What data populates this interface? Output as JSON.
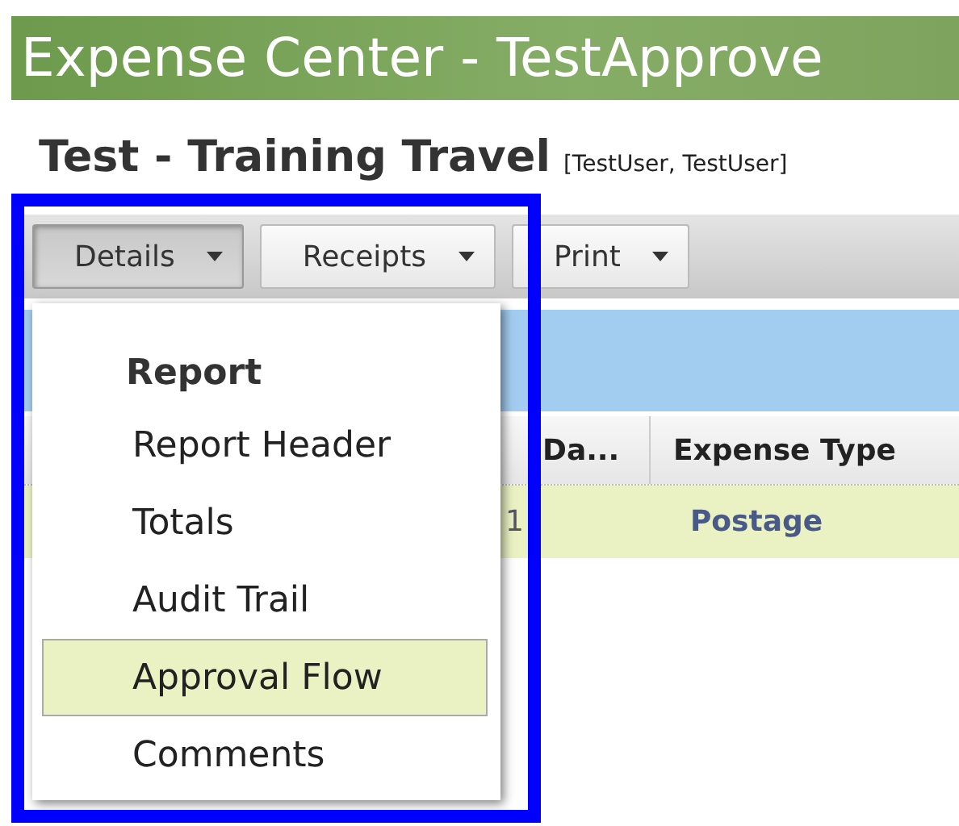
{
  "header": {
    "title": "Expense Center - TestApprove"
  },
  "report": {
    "title": "Test - Training Travel",
    "owner": "[TestUser, TestUser]"
  },
  "toolbar": {
    "buttons": [
      {
        "label": "Details",
        "pressed": true
      },
      {
        "label": "Receipts",
        "pressed": false
      },
      {
        "label": "Print",
        "pressed": false
      }
    ]
  },
  "table": {
    "columns": [
      {
        "label": "Da..."
      },
      {
        "label": "Expense Type"
      }
    ],
    "rows": [
      {
        "cells": [
          "1",
          "Postage"
        ]
      }
    ]
  },
  "menu": {
    "items": [
      {
        "kind": "heading",
        "label": "Report"
      },
      {
        "kind": "item",
        "label": "Report Header",
        "selected": false
      },
      {
        "kind": "item",
        "label": "Totals",
        "selected": false
      },
      {
        "kind": "item",
        "label": "Audit Trail",
        "selected": false
      },
      {
        "kind": "item",
        "label": "Approval Flow",
        "selected": true
      },
      {
        "kind": "item",
        "label": "Comments",
        "selected": false
      }
    ]
  }
}
